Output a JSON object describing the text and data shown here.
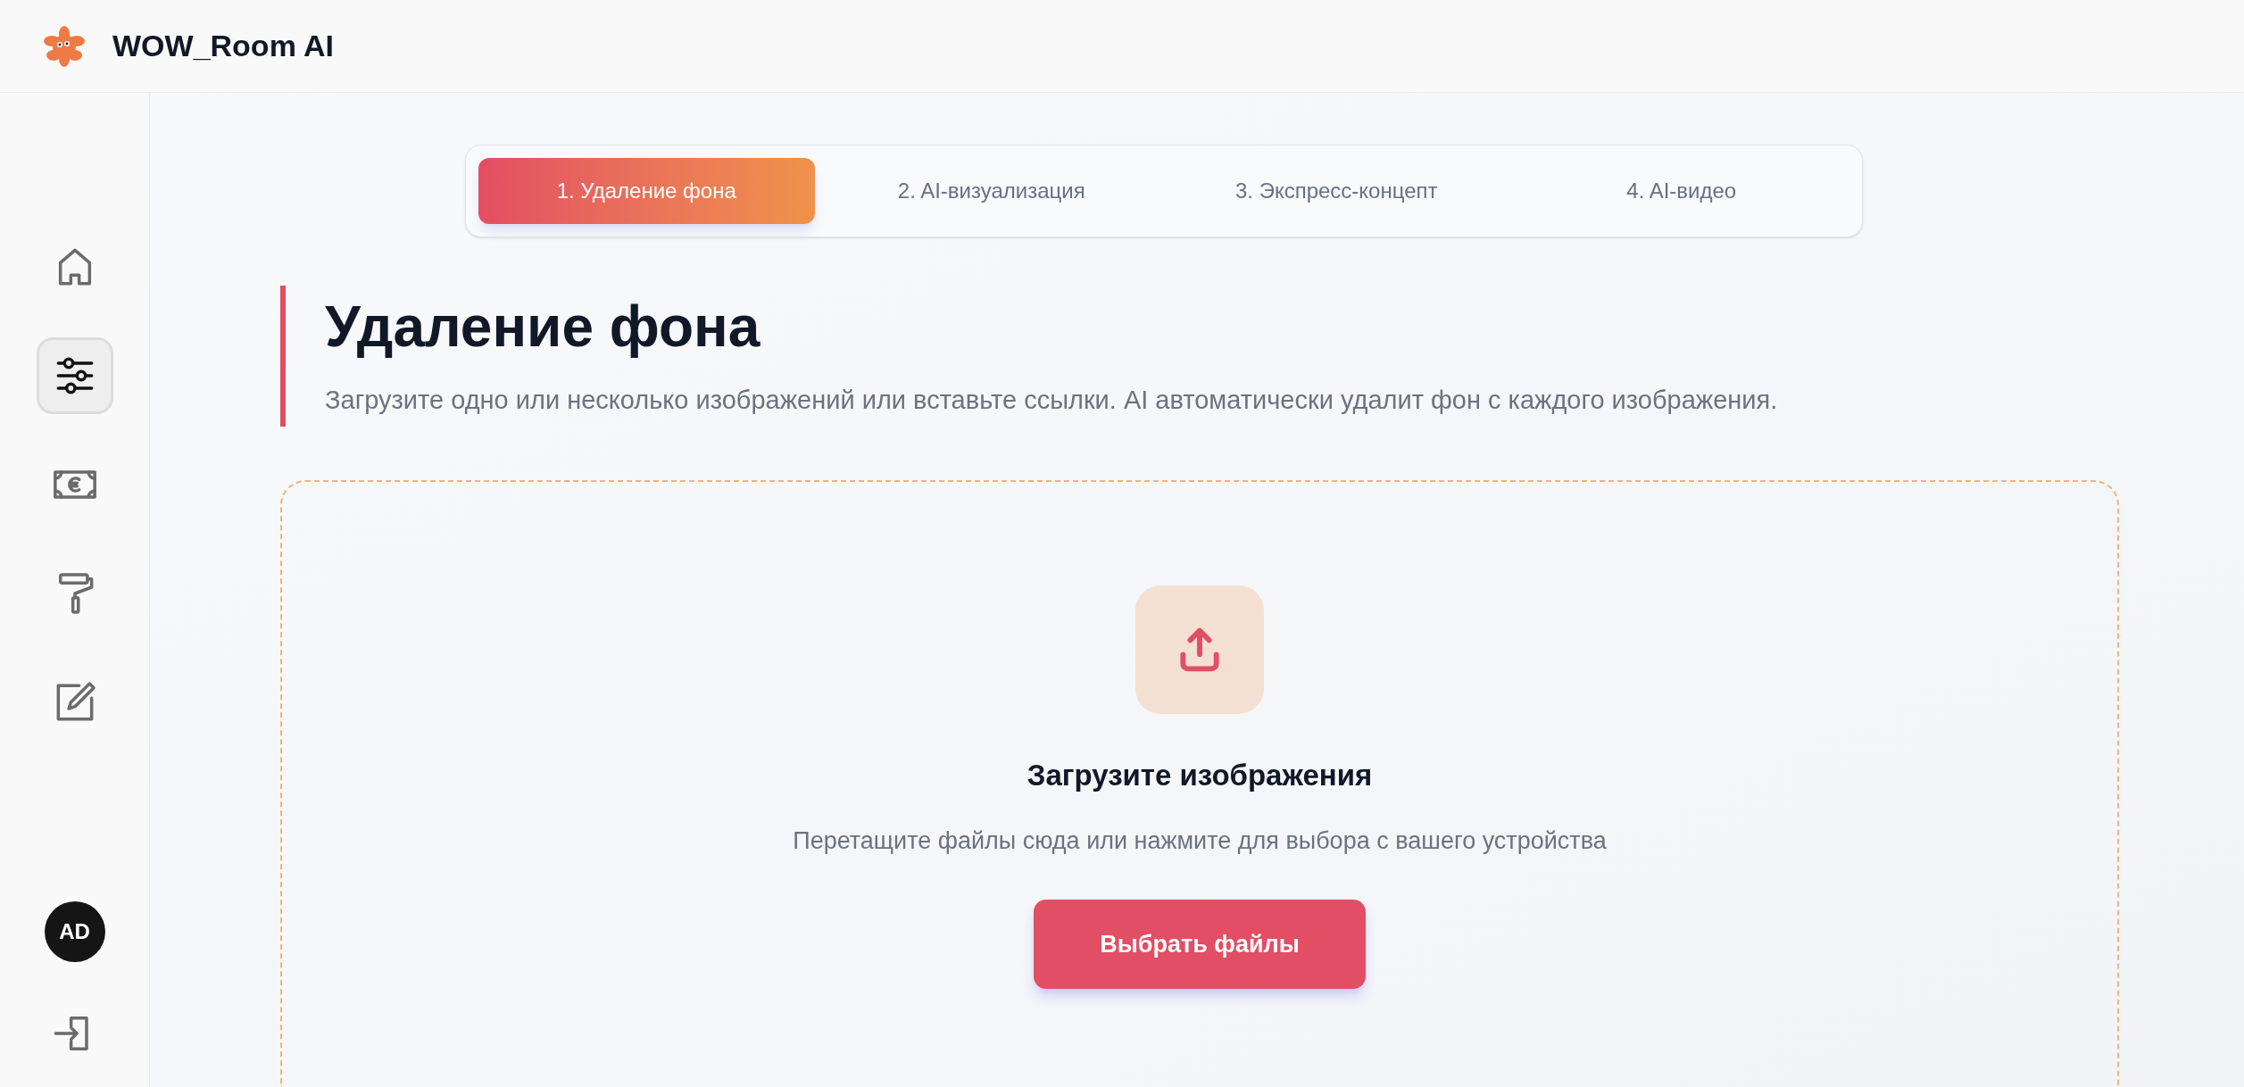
{
  "header": {
    "app_name": "WOW_Room AI"
  },
  "sidebar": {
    "items": [
      {
        "selected": false
      },
      {
        "selected": true
      },
      {
        "selected": false
      },
      {
        "selected": false
      },
      {
        "selected": false
      }
    ],
    "avatar": "AD"
  },
  "tabs": [
    {
      "label": "1. Удаление фона",
      "selected": true
    },
    {
      "label": "2. AI-визуализация",
      "selected": false
    },
    {
      "label": "3. Экспресс-концепт",
      "selected": false
    },
    {
      "label": "4. AI-видео",
      "selected": false
    }
  ],
  "section": {
    "title": "Удаление фона",
    "description": "Загрузите одно или несколько изображений или вставьте ссылки. AI автоматически удалит фон с каждого изображения."
  },
  "upload": {
    "title": "Загрузите изображения",
    "hint": "Перетащите файлы сюда или нажмите для выбора с вашего устройства",
    "button": "Выбрать файлы"
  }
}
